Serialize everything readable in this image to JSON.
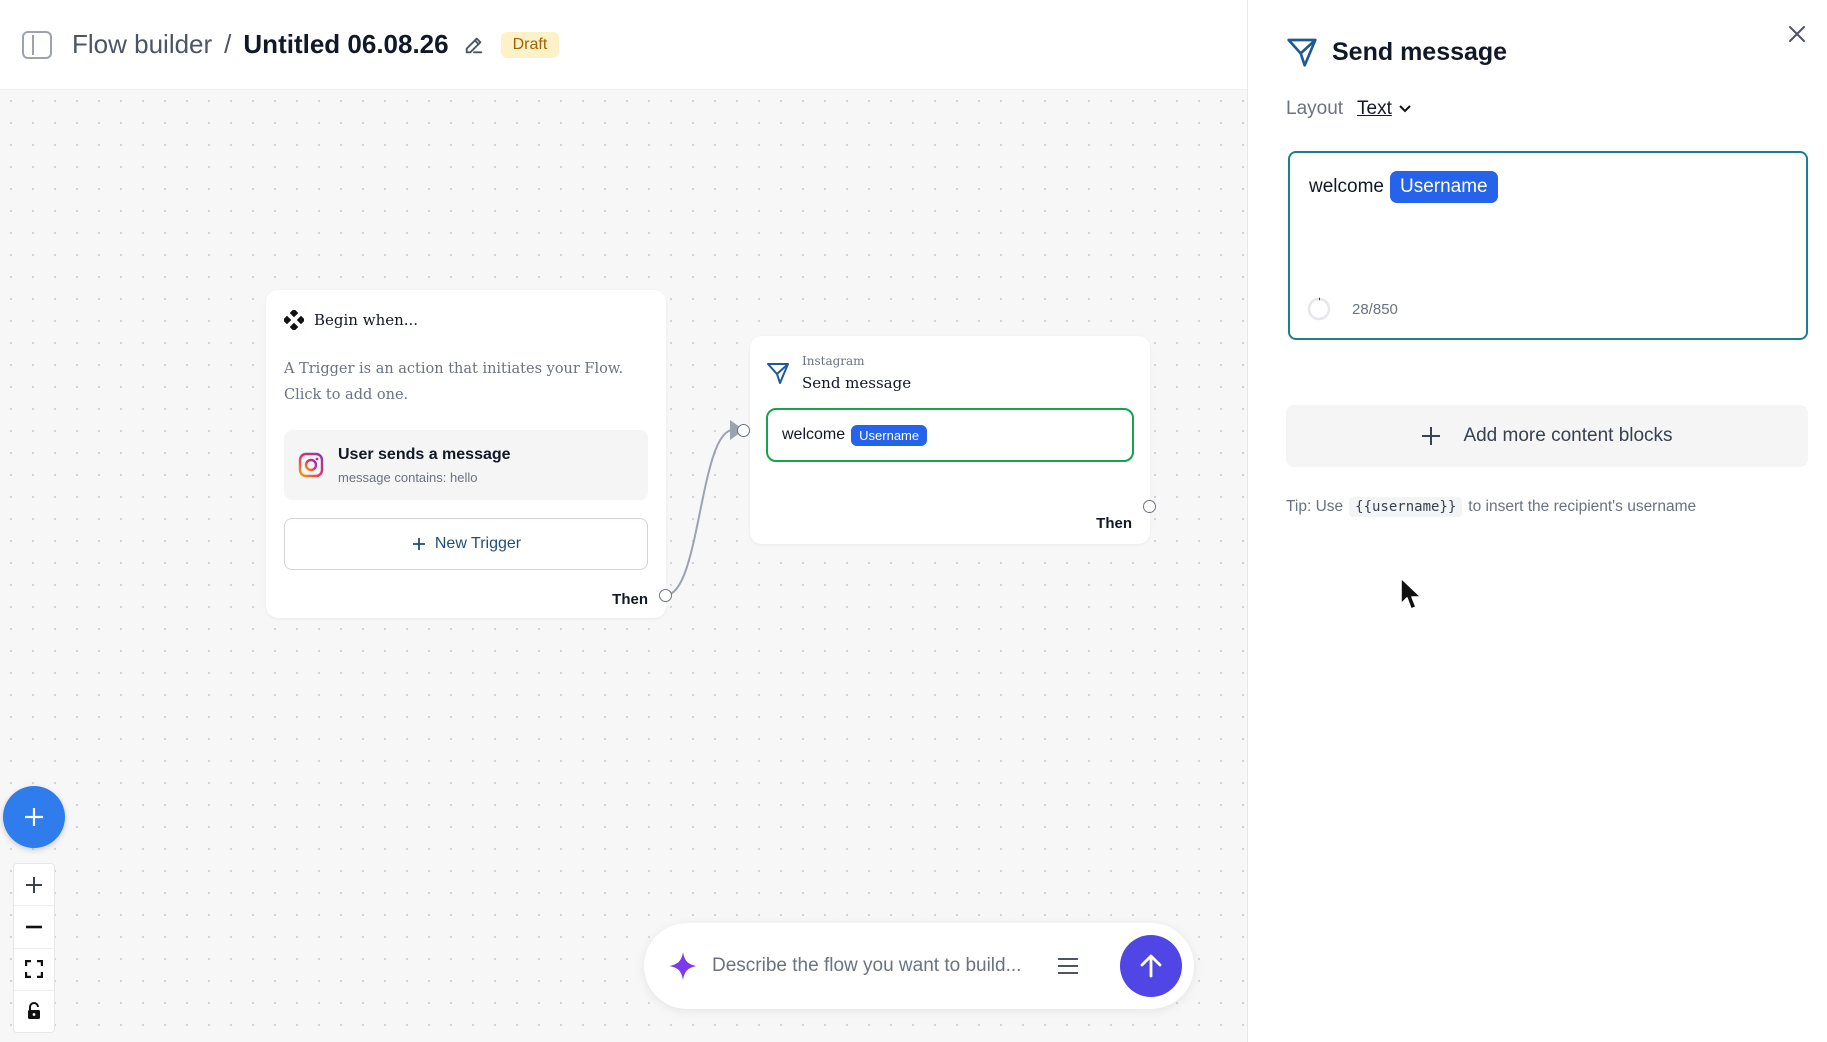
{
  "header": {
    "breadcrumb_root": "Flow builder",
    "separator": "/",
    "flow_name": "Untitled 06.08.26",
    "status_badge": "Draft"
  },
  "canvas": {
    "trigger_node": {
      "title": "Begin when...",
      "description": "A Trigger is an action that initiates your Flow. Click to add one.",
      "trigger": {
        "icon": "instagram-icon",
        "title": "User sends a message",
        "subtitle": "message contains: hello"
      },
      "new_trigger_label": "New Trigger",
      "then_label": "Then"
    },
    "message_node": {
      "platform": "Instagram",
      "title": "Send message",
      "text": "welcome",
      "variable": "Username",
      "then_label": "Then"
    },
    "prompt": {
      "placeholder": "Describe the flow you want to build..."
    }
  },
  "panel": {
    "title": "Send message",
    "layout_label": "Layout",
    "layout_value": "Text",
    "editor_text": "welcome",
    "editor_variable": "Username",
    "char_counter": "28/850",
    "add_blocks_label": "Add more content blocks",
    "tip_prefix": "Tip: Use",
    "tip_code": "{{username}}",
    "tip_suffix": "to insert the recipient's username"
  },
  "colors": {
    "primary_blue": "#2f7ded",
    "variable_pill": "#2563eb",
    "editor_border": "#1a7f92",
    "preview_border": "#16a34a",
    "send_button": "#4f46e5",
    "draft_badge_bg": "#fdf1c7"
  }
}
